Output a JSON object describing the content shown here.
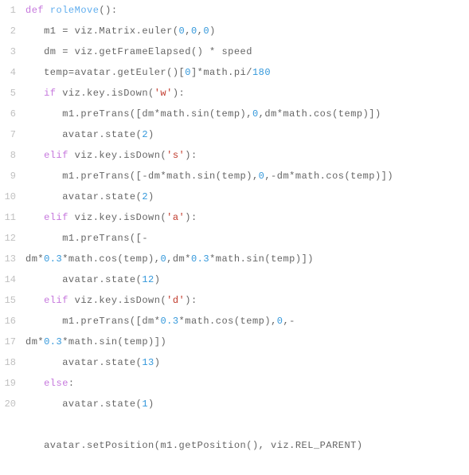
{
  "code": {
    "lines": [
      {
        "n": "1",
        "segs": [
          {
            "t": "def ",
            "c": "kw"
          },
          {
            "t": "roleMove",
            "c": "fn"
          },
          {
            "t": "():",
            "c": "plain"
          }
        ],
        "indent": 0
      },
      {
        "n": "2",
        "segs": [
          {
            "t": "m1 = viz.Matrix.euler(",
            "c": "plain"
          },
          {
            "t": "0",
            "c": "num"
          },
          {
            "t": ",",
            "c": "plain"
          },
          {
            "t": "0",
            "c": "num"
          },
          {
            "t": ",",
            "c": "plain"
          },
          {
            "t": "0",
            "c": "num"
          },
          {
            "t": ")",
            "c": "plain"
          }
        ],
        "indent": 3
      },
      {
        "n": "3",
        "segs": [
          {
            "t": "dm = viz.getFrameElapsed() * speed",
            "c": "plain"
          }
        ],
        "indent": 3
      },
      {
        "n": "4",
        "segs": [
          {
            "t": "temp=avatar.getEuler()[",
            "c": "plain"
          },
          {
            "t": "0",
            "c": "num"
          },
          {
            "t": "]*math.pi/",
            "c": "plain"
          },
          {
            "t": "180",
            "c": "num"
          }
        ],
        "indent": 3
      },
      {
        "n": "5",
        "segs": [
          {
            "t": "if",
            "c": "kw"
          },
          {
            "t": " viz.key.isDown(",
            "c": "plain"
          },
          {
            "t": "'w'",
            "c": "str"
          },
          {
            "t": "):",
            "c": "plain"
          }
        ],
        "indent": 3
      },
      {
        "n": "6",
        "segs": [
          {
            "t": "m1.preTrans([dm*math.sin(temp),",
            "c": "plain"
          },
          {
            "t": "0",
            "c": "num"
          },
          {
            "t": ",dm*math.cos(temp)])",
            "c": "plain"
          }
        ],
        "indent": 6
      },
      {
        "n": "7",
        "segs": [
          {
            "t": "avatar.state(",
            "c": "plain"
          },
          {
            "t": "2",
            "c": "num"
          },
          {
            "t": ")",
            "c": "plain"
          }
        ],
        "indent": 6
      },
      {
        "n": "8",
        "segs": [
          {
            "t": "elif",
            "c": "kw"
          },
          {
            "t": " viz.key.isDown(",
            "c": "plain"
          },
          {
            "t": "'s'",
            "c": "str"
          },
          {
            "t": "):",
            "c": "plain"
          }
        ],
        "indent": 3
      },
      {
        "n": "9",
        "segs": [
          {
            "t": "m1.preTrans([-dm*math.sin(temp),",
            "c": "plain"
          },
          {
            "t": "0",
            "c": "num"
          },
          {
            "t": ",-dm*math.cos(temp)])",
            "c": "plain"
          }
        ],
        "indent": 6
      },
      {
        "n": "10",
        "segs": [
          {
            "t": "avatar.state(",
            "c": "plain"
          },
          {
            "t": "2",
            "c": "num"
          },
          {
            "t": ")",
            "c": "plain"
          }
        ],
        "indent": 6
      },
      {
        "n": "11",
        "segs": [
          {
            "t": "elif",
            "c": "kw"
          },
          {
            "t": " viz.key.isDown(",
            "c": "plain"
          },
          {
            "t": "'a'",
            "c": "str"
          },
          {
            "t": "):",
            "c": "plain"
          }
        ],
        "indent": 3
      },
      {
        "n": "12",
        "segs": [
          {
            "t": "m1.preTrans([-",
            "c": "plain"
          }
        ],
        "indent": 6
      },
      {
        "n": "13",
        "segs": [
          {
            "t": "dm*",
            "c": "plain"
          },
          {
            "t": "0.3",
            "c": "num"
          },
          {
            "t": "*math.cos(temp),",
            "c": "plain"
          },
          {
            "t": "0",
            "c": "num"
          },
          {
            "t": ",dm*",
            "c": "plain"
          },
          {
            "t": "0.3",
            "c": "num"
          },
          {
            "t": "*math.sin(temp)])",
            "c": "plain"
          }
        ],
        "indent": 0
      },
      {
        "n": "14",
        "segs": [
          {
            "t": "avatar.state(",
            "c": "plain"
          },
          {
            "t": "12",
            "c": "num"
          },
          {
            "t": ")",
            "c": "plain"
          }
        ],
        "indent": 6
      },
      {
        "n": "15",
        "segs": [
          {
            "t": "elif",
            "c": "kw"
          },
          {
            "t": " viz.key.isDown(",
            "c": "plain"
          },
          {
            "t": "'d'",
            "c": "str"
          },
          {
            "t": "):",
            "c": "plain"
          }
        ],
        "indent": 3
      },
      {
        "n": "16",
        "segs": [
          {
            "t": "m1.preTrans([dm*",
            "c": "plain"
          },
          {
            "t": "0.3",
            "c": "num"
          },
          {
            "t": "*math.cos(temp),",
            "c": "plain"
          },
          {
            "t": "0",
            "c": "num"
          },
          {
            "t": ",-",
            "c": "plain"
          }
        ],
        "indent": 6
      },
      {
        "n": "17",
        "segs": [
          {
            "t": "dm*",
            "c": "plain"
          },
          {
            "t": "0.3",
            "c": "num"
          },
          {
            "t": "*math.sin(temp)])",
            "c": "plain"
          }
        ],
        "indent": 0
      },
      {
        "n": "18",
        "segs": [
          {
            "t": "avatar.state(",
            "c": "plain"
          },
          {
            "t": "13",
            "c": "num"
          },
          {
            "t": ")",
            "c": "plain"
          }
        ],
        "indent": 6
      },
      {
        "n": "19",
        "segs": [
          {
            "t": "else",
            "c": "kw"
          },
          {
            "t": ":",
            "c": "plain"
          }
        ],
        "indent": 3
      },
      {
        "n": "20",
        "segs": [
          {
            "t": "avatar.state(",
            "c": "plain"
          },
          {
            "t": "1",
            "c": "num"
          },
          {
            "t": ")",
            "c": "plain"
          }
        ],
        "indent": 6
      },
      {
        "n": "",
        "segs": [],
        "indent": 0
      },
      {
        "n": "",
        "segs": [
          {
            "t": "avatar.setPosition(m1.getPosition(), viz.REL_PARENT)",
            "c": "plain"
          }
        ],
        "indent": 3
      }
    ]
  }
}
